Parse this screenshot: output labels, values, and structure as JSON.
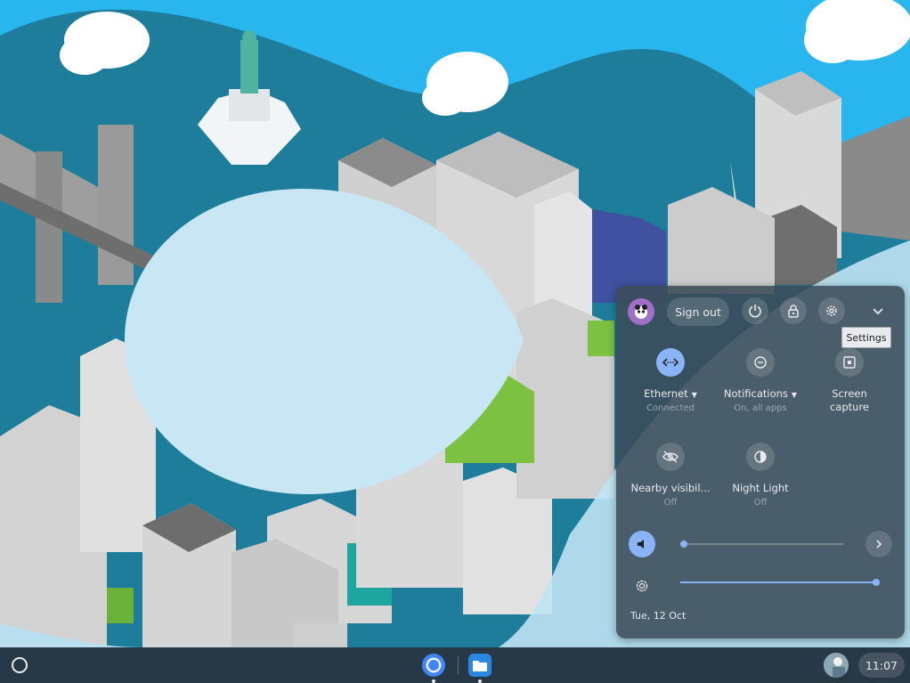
{
  "quick_settings": {
    "sign_out_label": "Sign out",
    "tooltip": "Settings",
    "features": [
      {
        "label": "Ethernet",
        "sublabel": "Connected",
        "icon": "ethernet-icon",
        "active": true
      },
      {
        "label": "Notifications",
        "sublabel": "On, all apps",
        "icon": "notifications-icon",
        "active": false
      },
      {
        "label": "Screen",
        "label2": "capture",
        "icon": "screen-capture-icon",
        "active": false
      },
      {
        "label": "Nearby visibil...",
        "sublabel": "Off",
        "icon": "nearby-share-icon",
        "active": false
      },
      {
        "label": "Night Light",
        "sublabel": "Off",
        "icon": "night-light-icon",
        "active": false
      }
    ],
    "volume_level": 0.0,
    "brightness_level": 1.0,
    "date": "Tue, 12 Oct"
  },
  "shelf": {
    "apps": [
      {
        "name": "Chrome",
        "icon": "chrome-icon"
      },
      {
        "name": "Files",
        "icon": "files-icon"
      }
    ],
    "time": "11:07"
  },
  "colors": {
    "accent": "#8ab4f8",
    "sky": "#29b6ee",
    "hill": "#1f7d9c",
    "panel": "#3c4b58"
  }
}
